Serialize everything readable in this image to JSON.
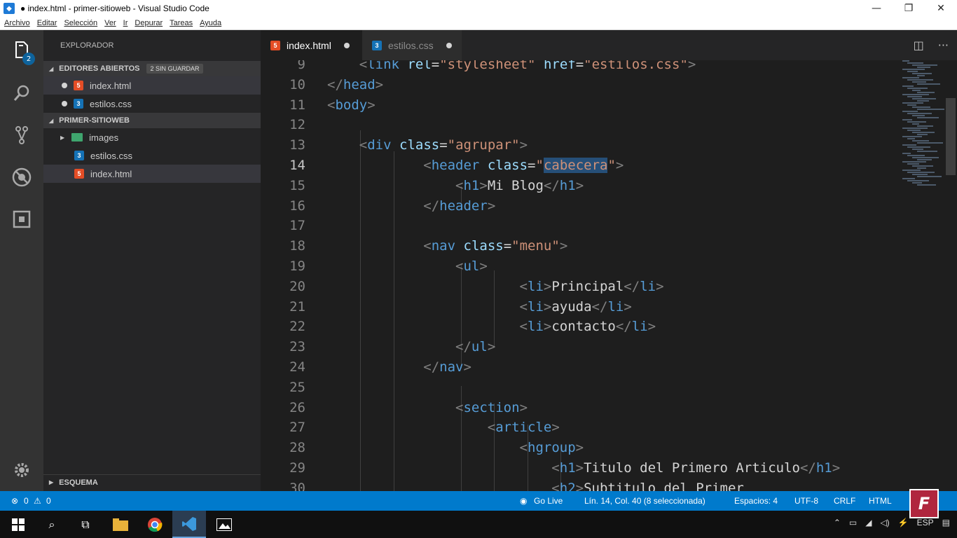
{
  "window": {
    "title": "● index.html - primer-sitioweb - Visual Studio Code"
  },
  "menu": [
    "Archivo",
    "Editar",
    "Selección",
    "Ver",
    "Ir",
    "Depurar",
    "Tareas",
    "Ayuda"
  ],
  "activity": {
    "badge_count": "2"
  },
  "sidebar": {
    "title": "EXPLORADOR",
    "open_editors": {
      "label": "EDITORES ABIERTOS",
      "unsaved_badge": "2 SIN GUARDAR",
      "items": [
        {
          "name": "index.html",
          "type": "html"
        },
        {
          "name": "estilos.css",
          "type": "css"
        }
      ]
    },
    "project": {
      "label": "PRIMER-SITIOWEB",
      "items": [
        {
          "name": "images",
          "type": "folder"
        },
        {
          "name": "estilos.css",
          "type": "css"
        },
        {
          "name": "index.html",
          "type": "html"
        }
      ]
    },
    "outline": {
      "label": "ESQUEMA"
    }
  },
  "tabs": [
    {
      "label": "index.html",
      "type": "html",
      "active": true,
      "dirty": true
    },
    {
      "label": "estilos.css",
      "type": "css",
      "active": false,
      "dirty": true
    }
  ],
  "editor": {
    "current_line": 14,
    "lines": [
      {
        "n": "9",
        "text": "        <link rel=\"stylesheet\" href=\"estilos.css\">"
      },
      {
        "n": "10",
        "text": "    </head>"
      },
      {
        "n": "11",
        "text": "    <body>"
      },
      {
        "n": "12",
        "text": ""
      },
      {
        "n": "13",
        "text": "        <div class=\"agrupar\">"
      },
      {
        "n": "14",
        "text": "                <header class=\"cabecera\">"
      },
      {
        "n": "15",
        "text": "                    <h1>Mi Blog</h1>"
      },
      {
        "n": "16",
        "text": "                </header>"
      },
      {
        "n": "17",
        "text": ""
      },
      {
        "n": "18",
        "text": "                <nav class=\"menu\">"
      },
      {
        "n": "19",
        "text": "                    <ul>"
      },
      {
        "n": "20",
        "text": "                            <li>Principal</li>"
      },
      {
        "n": "21",
        "text": "                            <li>ayuda</li>"
      },
      {
        "n": "22",
        "text": "                            <li>contacto</li>"
      },
      {
        "n": "23",
        "text": "                    </ul>"
      },
      {
        "n": "24",
        "text": "                </nav>"
      },
      {
        "n": "25",
        "text": ""
      },
      {
        "n": "26",
        "text": "                    <section>"
      },
      {
        "n": "27",
        "text": "                        <article>"
      },
      {
        "n": "28",
        "text": "                            <hgroup>"
      },
      {
        "n": "29",
        "text": "                                <h1>Titulo del Primero Articulo</h1>"
      },
      {
        "n": "30",
        "text": "                                <h2>Subtitulo del Primer"
      }
    ]
  },
  "statusbar": {
    "errors": "0",
    "warnings": "0",
    "go_live": "Go Live",
    "position": "Lín. 14, Col. 40 (8 seleccionada)",
    "spaces": "Espacios: 4",
    "encoding": "UTF-8",
    "eol": "CRLF",
    "language": "HTML"
  },
  "taskbar": {
    "tray_lang": "ESP"
  },
  "colors": {
    "accent": "#007acc",
    "tag": "#569cd6",
    "attr": "#9cdcfe",
    "string": "#ce9178"
  }
}
